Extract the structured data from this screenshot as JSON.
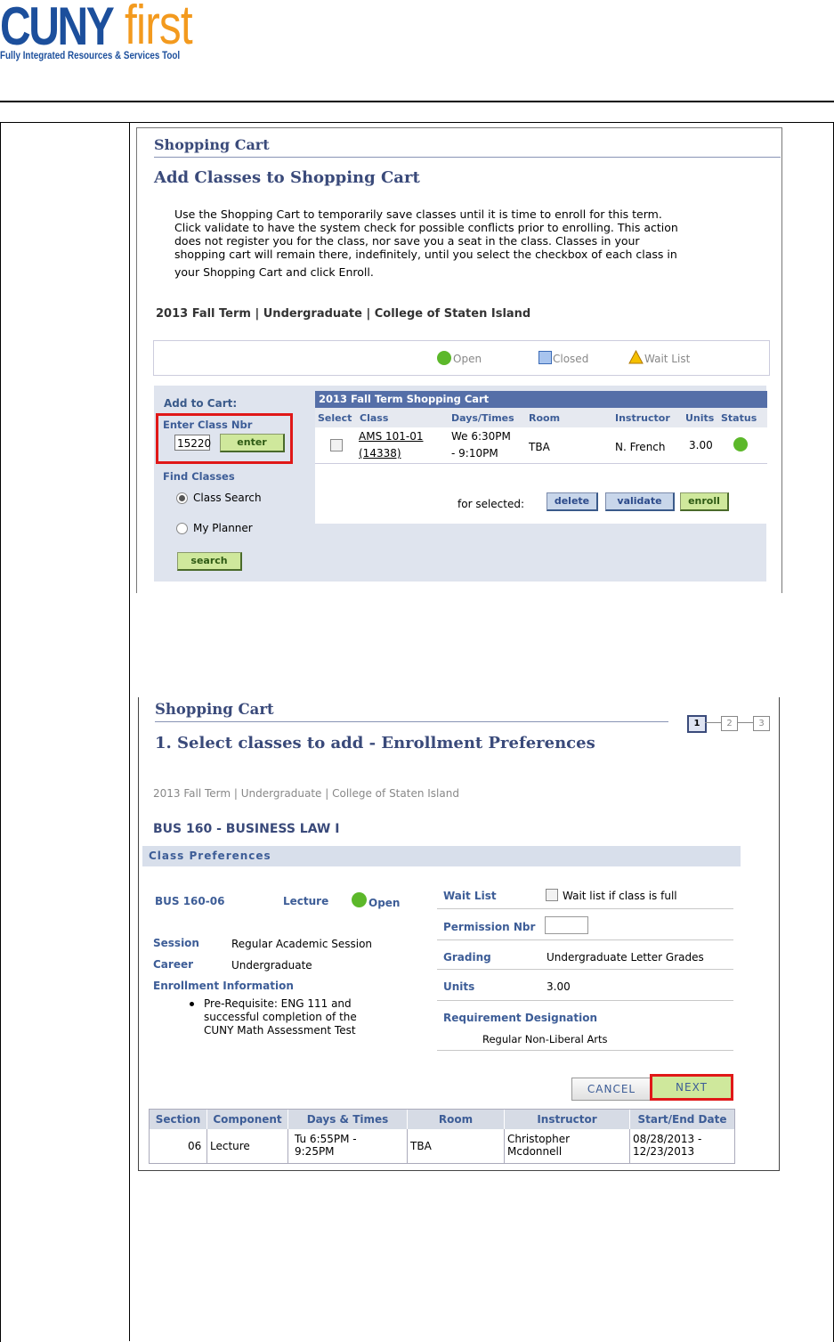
{
  "logo": {
    "cuny": "CUNY",
    "first": "first",
    "tagline": "Fully Integrated Resources & Services Tool"
  },
  "shot1": {
    "header": "Shopping Cart",
    "title": "Add Classes to Shopping Cart",
    "instructions": [
      "Use the Shopping Cart to temporarily save classes until it is time to enroll for this term.",
      "Click validate to have the system check for possible conflicts prior to enrolling. This action",
      "does not register you for the class, nor save you a seat in the class. Classes in your",
      "shopping cart will remain there, indefinitely, until you select the checkbox of each class in",
      "your Shopping Cart and click Enroll."
    ],
    "term_line": "2013 Fall Term | Undergraduate | College of Staten Island",
    "legend": {
      "open": "Open",
      "closed": "Closed",
      "wait": "Wait List"
    },
    "add_to_cart": "Add to Cart:",
    "enter_class_nbr": "Enter Class Nbr",
    "class_nbr_value": "15220",
    "enter_button": "enter",
    "find_classes": "Find Classes",
    "class_search": "Class Search",
    "my_planner": "My Planner",
    "search_button": "search",
    "cart_title": "2013 Fall Term Shopping Cart",
    "columns": [
      "Select",
      "Class",
      "Days/Times",
      "Room",
      "Instructor",
      "Units",
      "Status"
    ],
    "row": {
      "class_line1": "AMS 101-01",
      "class_line2": "(14338)",
      "days_line1": "We 6:30PM",
      "days_line2": "- 9:10PM",
      "room": "TBA",
      "instructor": "N. French",
      "units": "3.00"
    },
    "for_selected": "for selected:",
    "delete_button": "delete",
    "validate_button": "validate",
    "enroll_button": "enroll"
  },
  "shot2": {
    "header": "Shopping Cart",
    "steps": [
      "1",
      "2",
      "3"
    ],
    "title": "1.  Select classes to add - Enrollment Preferences",
    "term_line": "2013 Fall Term | Undergraduate | College of Staten Island",
    "course": "BUS  160 - BUSINESS LAW I",
    "class_prefs": "Class Preferences",
    "section_code": "BUS  160-06",
    "component": "Lecture",
    "status": "Open",
    "session_label": "Session",
    "session_value": "Regular Academic Session",
    "career_label": "Career",
    "career_value": "Undergraduate",
    "enroll_info": "Enrollment Information",
    "prereq_lines": [
      "Pre-Requisite: ENG 111 and",
      "successful completion of the",
      "CUNY Math Assessment Test"
    ],
    "wait_list_label": "Wait List",
    "wait_list_text": "Wait list if class is full",
    "permission_label": "Permission Nbr",
    "grading_label": "Grading",
    "grading_value": "Undergraduate Letter Grades",
    "units_label": "Units",
    "units_value": "3.00",
    "req_label": "Requirement Designation",
    "req_value": "Regular Non-Liberal Arts",
    "cancel_button": "CANCEL",
    "next_button": "NEXT",
    "grid_headers": [
      "Section",
      "Component",
      "Days & Times",
      "Room",
      "Instructor",
      "Start/End Date"
    ],
    "grid_row": {
      "section": "06",
      "component": "Lecture",
      "days1": "Tu 6:55PM -",
      "days2": "9:25PM",
      "room": "TBA",
      "instr1": "Christopher",
      "instr2": "Mcdonnell",
      "date1": "08/28/2013 -",
      "date2": "12/23/2013"
    }
  },
  "colors": {
    "open_green": "#5cb82a",
    "closed_blue": "#6e9ad6",
    "wait_yellow": "#f5b400",
    "highlight_red": "#e01818"
  }
}
